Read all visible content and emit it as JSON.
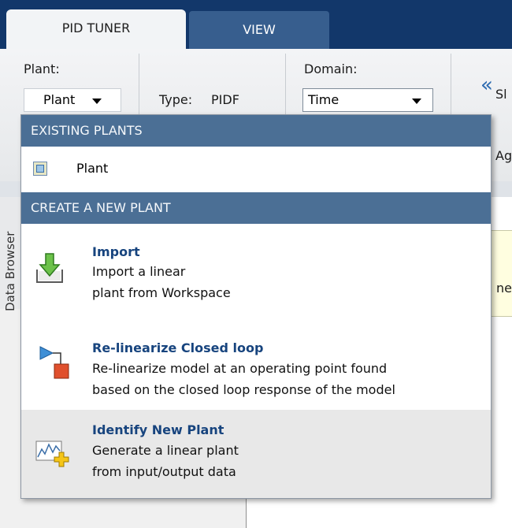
{
  "tabs": [
    {
      "label": "PID TUNER",
      "active": true
    },
    {
      "label": "VIEW",
      "active": false
    }
  ],
  "toolstrip": {
    "plant_label": "Plant:",
    "plant_button": "Plant",
    "type_label": "Type:",
    "type_value": "PIDF",
    "domain_label": "Domain:",
    "domain_value": "Time",
    "collapse_icon": "«",
    "cut_text_1": "Sl",
    "cut_text_2": "Ag"
  },
  "side": {
    "vertical_tab": "Data Browser",
    "cut_text": "ne"
  },
  "menu": {
    "existing_header": "EXISTING PLANTS",
    "existing_items": [
      {
        "label": "Plant",
        "icon": "plant-model-icon"
      }
    ],
    "create_header": "CREATE A NEW PLANT",
    "create_items": [
      {
        "title": "Import",
        "lines": [
          "Import a linear",
          "plant from Workspace"
        ],
        "icon": "import-arrow-icon"
      },
      {
        "title": "Re-linearize Closed loop",
        "lines": [
          "Re-linearize model at an operating point found",
          "based on the closed loop response of the model"
        ],
        "icon": "relinearize-icon"
      },
      {
        "title": "Identify New Plant",
        "lines": [
          "Generate a linear plant",
          "from input/output data"
        ],
        "icon": "identify-plant-icon"
      }
    ]
  },
  "colors": {
    "tabstrip_bg": "#12376a",
    "section_header_bg": "#4b6f95",
    "link_title": "#17447e"
  }
}
